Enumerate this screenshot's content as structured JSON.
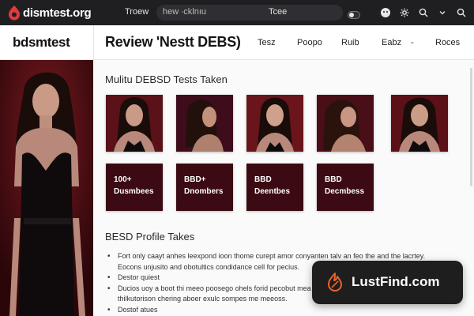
{
  "topbar": {
    "brand": "dismtest.org",
    "tab_label": "Troew",
    "address_left": "hew ∙cklnıu",
    "address_center": "Tcee"
  },
  "header": {
    "site_name": "bdsmtest",
    "page_title": "Review 'Nestt DEBS)",
    "nav": [
      "Tesz",
      "Poopo",
      "Ruib",
      "Eabz",
      "Roces"
    ],
    "nav_separator": "-"
  },
  "main": {
    "section1_title": "Mulitu DEBSD Tests Taken",
    "tiles": [
      {
        "line1": "100+",
        "line2": "Dusmbees"
      },
      {
        "line1": "BBD+",
        "line2": "Dnombers"
      },
      {
        "line1": "BBD",
        "line2": "Deentbes"
      },
      {
        "line1": "BBD",
        "line2": "Decmbess"
      }
    ],
    "section2_title": "BESD Profile Takes",
    "bullets": [
      "Fort only caayt anhes leexpond ioon thome curept amor conyanten talv an feo the and the lacrtey. Eocons unjusito and obotultics condidance cell for pecius.",
      "Destor quiest",
      "Ducios uoy a boot thi meeo poosego ohels forid pecobut mea a boleve holy rooor ploms fm the agoo thilkutorison chering aboer exulc sompes me meeoss.",
      "Dostof atues"
    ]
  },
  "badge": {
    "text": "LustFind.com"
  },
  "colors": {
    "topbar_bg": "#1f1f22",
    "accent_red": "#e23a3a",
    "tile_bg": "#3b0a12",
    "badge_bg": "#1e1e1e",
    "badge_icon": "#e8622a"
  },
  "icons": [
    "logo-icon",
    "toggle-icon",
    "smiley-icon",
    "settings-icon",
    "search-icon",
    "search-icon",
    "chevron-down-icon",
    "flame-icon"
  ]
}
